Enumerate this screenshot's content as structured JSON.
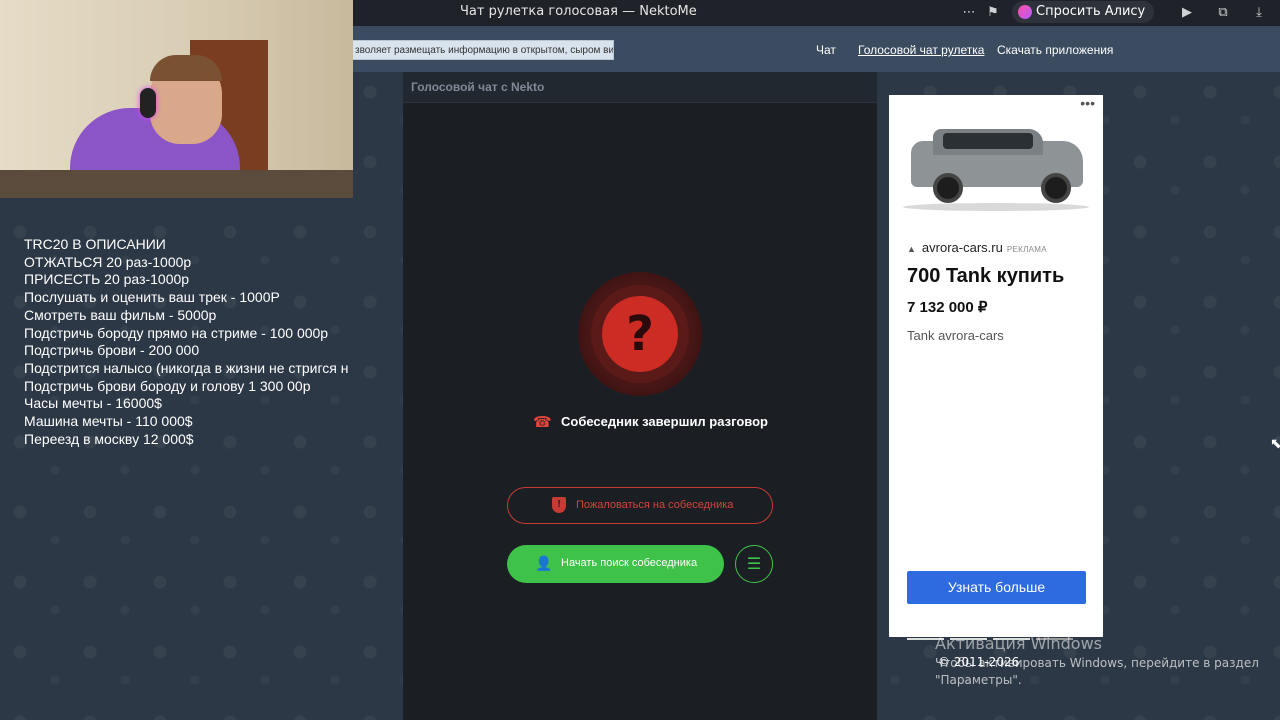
{
  "window": {
    "title": "Чат рулетка голосовая — NektoMe",
    "alice_label": "Спросить Алису AI",
    "more_icon": "ellipsis-icon",
    "bookmark_icon": "bookmark-icon"
  },
  "site": {
    "banner_text": "зволяет размещать информацию в открытом, сыром виде!",
    "nav": [
      {
        "label": "Чат"
      },
      {
        "label": "Голосовой чат рулетка"
      },
      {
        "label": "Скачать приложения"
      }
    ]
  },
  "overlay": {
    "lines": [
      "TRC20 В ОПИСАНИИ",
      "ОТЖАТЬСЯ 20 раз-1000р",
      "ПРИСЕСТЬ 20 раз-1000р",
      "Послушать и оценить ваш трек - 1000Р",
      "Смотреть ваш фильм - 5000р",
      "Подстричь бороду прямо на стриме - 100 000р",
      "Подстричь брови - 200 000",
      "Подстрится налысо (никогда в жизни не стригся н",
      "Подстричь брови бороду и голову 1 300 00р",
      "Часы мечты - 16000$",
      "Машина мечты - 110 000$",
      "Переезд в москву 12 000$"
    ]
  },
  "chat": {
    "header": "Голосовой чат с Nekto",
    "status_glyph": "?",
    "ended_text": "Собеседник завершил разговор",
    "complain_label": "Пожаловаться на собеседника",
    "start_label": "Начать поиск собеседника"
  },
  "ad": {
    "domain": "avrora-cars.ru",
    "tag": "РЕКЛАМА",
    "headline": "700 Tank купить",
    "price": "7 132 000 ₽",
    "subtitle": "Tank avrora-cars",
    "cta": "Узнать больше"
  },
  "footer": {
    "activation_title": "Активация Windows",
    "activation_text": "Чтобы активировать Windows, перейдите в раздел \"Параметры\".",
    "copyright": "© 2011-2026"
  },
  "colors": {
    "accent_green": "#3ec24a",
    "danger_red": "#cc2c24",
    "ad_button": "#2f6be0"
  }
}
